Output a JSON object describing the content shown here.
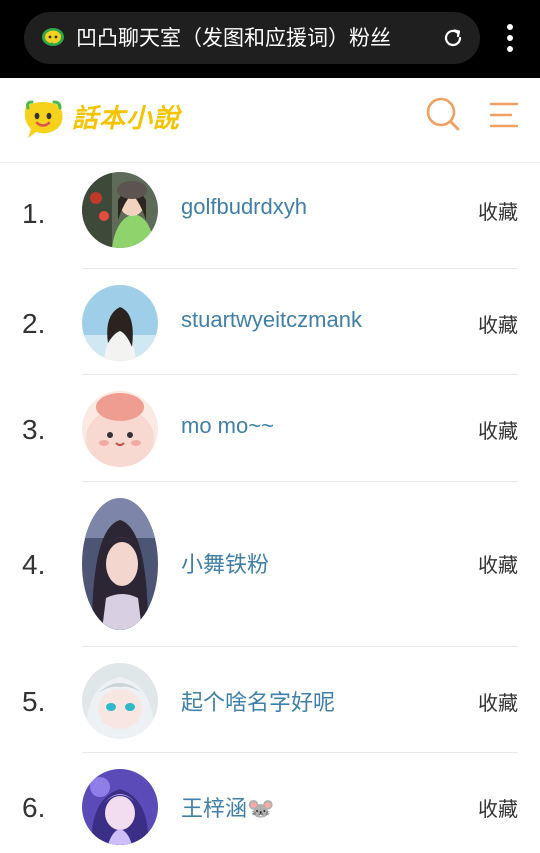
{
  "browser": {
    "tab_title": "凹凸聊天室（发图和应援词）粉丝",
    "site_icon": "chat-bubble-icon",
    "reload_icon": "reload-icon",
    "menu_icon": "more-vertical-icon"
  },
  "header": {
    "logo_text": "話本小說",
    "logo_icon": "mascot-logo-icon",
    "search_icon": "search-icon",
    "menu_icon": "hamburger-menu-icon",
    "accent_color": "#f0a060"
  },
  "fans": [
    {
      "rank": "1.",
      "name": "golfbudrdxyh",
      "action": "收藏"
    },
    {
      "rank": "2.",
      "name": "stuartwyeitczmank",
      "action": "收藏"
    },
    {
      "rank": "3.",
      "name": "mo mo~~",
      "action": "收藏"
    },
    {
      "rank": "4.",
      "name": "小舞铁粉",
      "action": "收藏"
    },
    {
      "rank": "5.",
      "name": "起个啥名字好呢",
      "action": "收藏"
    },
    {
      "rank": "6.",
      "name": "王梓涵🐭",
      "action": "收藏"
    }
  ]
}
